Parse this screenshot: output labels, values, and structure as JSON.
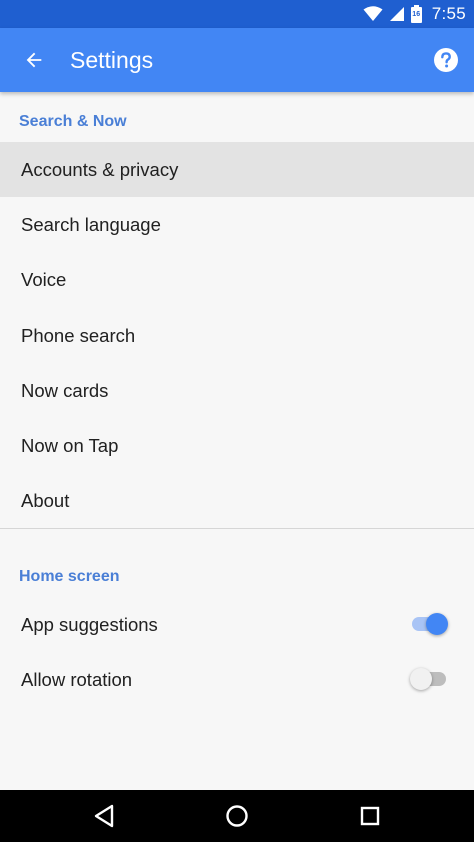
{
  "status_bar": {
    "time": "7:55",
    "icons": [
      "wifi-icon",
      "cell-signal-icon",
      "battery-icon"
    ],
    "battery_level": "16"
  },
  "app_bar": {
    "title": "Settings",
    "back_icon": "arrow-back-icon",
    "help_icon": "help-icon"
  },
  "sections": [
    {
      "header": "Search & Now",
      "items": [
        {
          "label": "Accounts & privacy"
        },
        {
          "label": "Search language"
        },
        {
          "label": "Voice"
        },
        {
          "label": "Phone search"
        },
        {
          "label": "Now cards"
        },
        {
          "label": "Now on Tap"
        },
        {
          "label": "About"
        }
      ]
    },
    {
      "header": "Home screen",
      "items": [
        {
          "label": "App suggestions",
          "toggle": true
        },
        {
          "label": "Allow rotation",
          "toggle": false
        }
      ]
    }
  ],
  "colors": {
    "status_bar": "#1f5fd0",
    "app_bar": "#4286f4",
    "section_header": "#4a7fd6",
    "selected_row": "#e3e3e3"
  },
  "nav_bar": {
    "icons": [
      "back-triangle-icon",
      "home-circle-icon",
      "recents-square-icon"
    ]
  }
}
